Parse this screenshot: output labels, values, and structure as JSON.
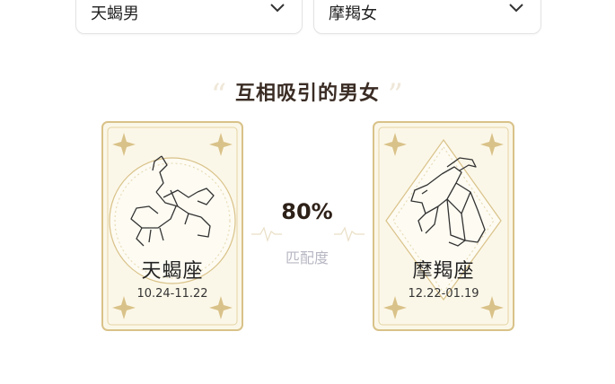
{
  "selectors": {
    "left": {
      "value": "天蝎男"
    },
    "right": {
      "value": "摩羯女"
    }
  },
  "section": {
    "title": "互相吸引的男女",
    "quote_open": "“",
    "quote_close": "”"
  },
  "match": {
    "percent": "80%",
    "label": "匹配度"
  },
  "cards": {
    "left": {
      "name": "天蝎座",
      "dates": "10.24-11.22",
      "icon": "scorpion-icon"
    },
    "right": {
      "name": "摩羯座",
      "dates": "12.22-01.19",
      "icon": "goat-icon"
    }
  },
  "colors": {
    "gold": "#d9c289",
    "card_bg": "#fbf7e8",
    "heading": "#3a2c24",
    "label_gray": "#b7b7c3"
  }
}
